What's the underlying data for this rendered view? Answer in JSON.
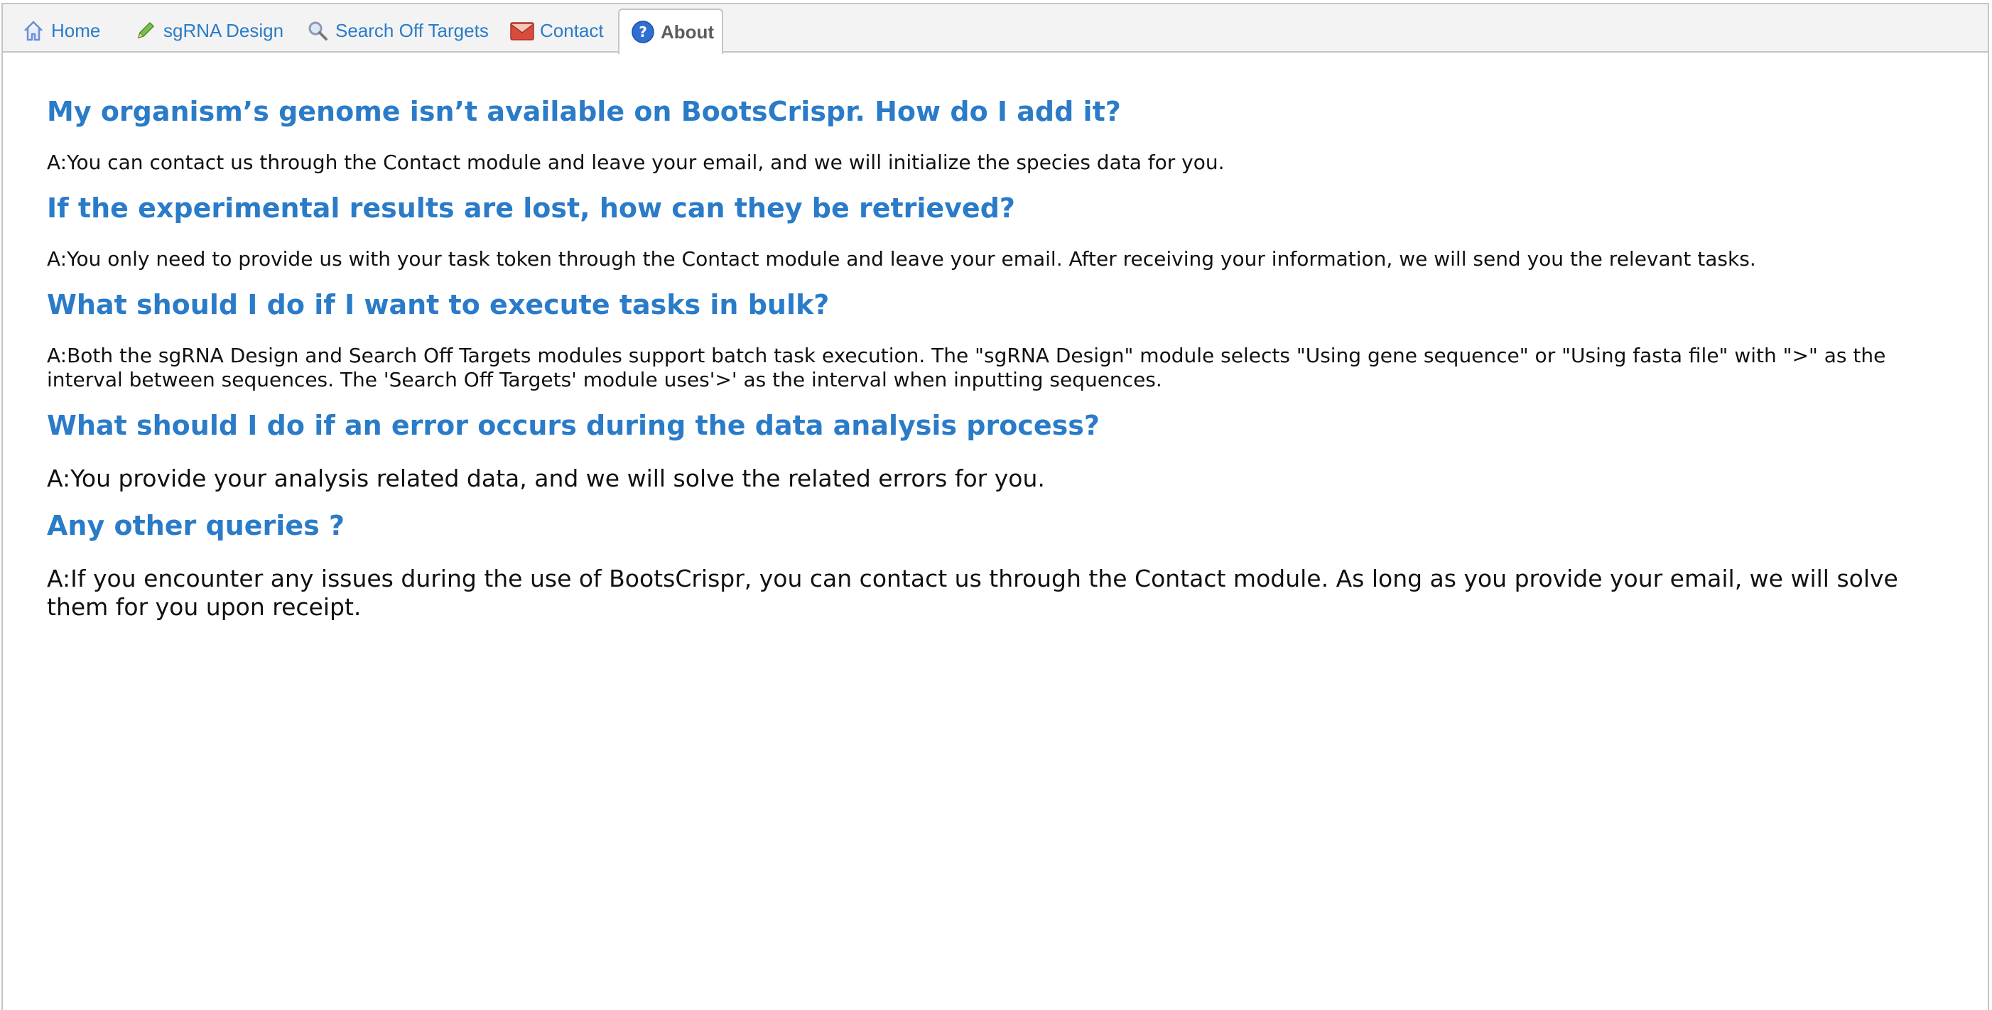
{
  "tabs": [
    {
      "label": "Home",
      "icon": "home-icon"
    },
    {
      "label": "sgRNA Design",
      "icon": "pencil-icon"
    },
    {
      "label": "Search Off Targets",
      "icon": "magnifier-icon"
    },
    {
      "label": "Contact",
      "icon": "envelope-icon"
    },
    {
      "label": "About",
      "icon": "question-icon",
      "active": true
    }
  ],
  "faq": [
    {
      "question": "My organism’s genome isn’t available on BootsCrispr. How do I add it?",
      "answer": "A:You can contact us through the Contact module and leave your email, and we will initialize the species data for you."
    },
    {
      "question": "If the experimental results are lost, how can they be retrieved?",
      "answer": "A:You only need to provide us with your task token through the Contact module and leave your email. After receiving your information, we will send you the relevant tasks."
    },
    {
      "question": "What should I do if I want to execute tasks in bulk?",
      "answer": "A:Both the sgRNA Design and Search Off Targets modules support batch task execution. The \"sgRNA Design\" module selects \"Using gene sequence\" or \"Using fasta file\" with \">\" as the interval between sequences. The 'Search Off Targets' module uses'>' as the interval when inputting sequences."
    },
    {
      "question": "What should I do if an error occurs during the data analysis process?",
      "answer": "A:You provide your analysis related data, and we will solve the related errors for you."
    },
    {
      "question": "Any other queries ?",
      "answer": "A:If you encounter any issues during the use of BootsCrispr, you can contact us through the Contact module. As long as you provide your email, we will solve them for you upon receipt."
    }
  ],
  "colors": {
    "heading": "#2a7bc8",
    "tab_link": "#2a7bc8",
    "active_tab_text": "#5c5c5c",
    "tabbar_bg": "#f3f3f3"
  }
}
